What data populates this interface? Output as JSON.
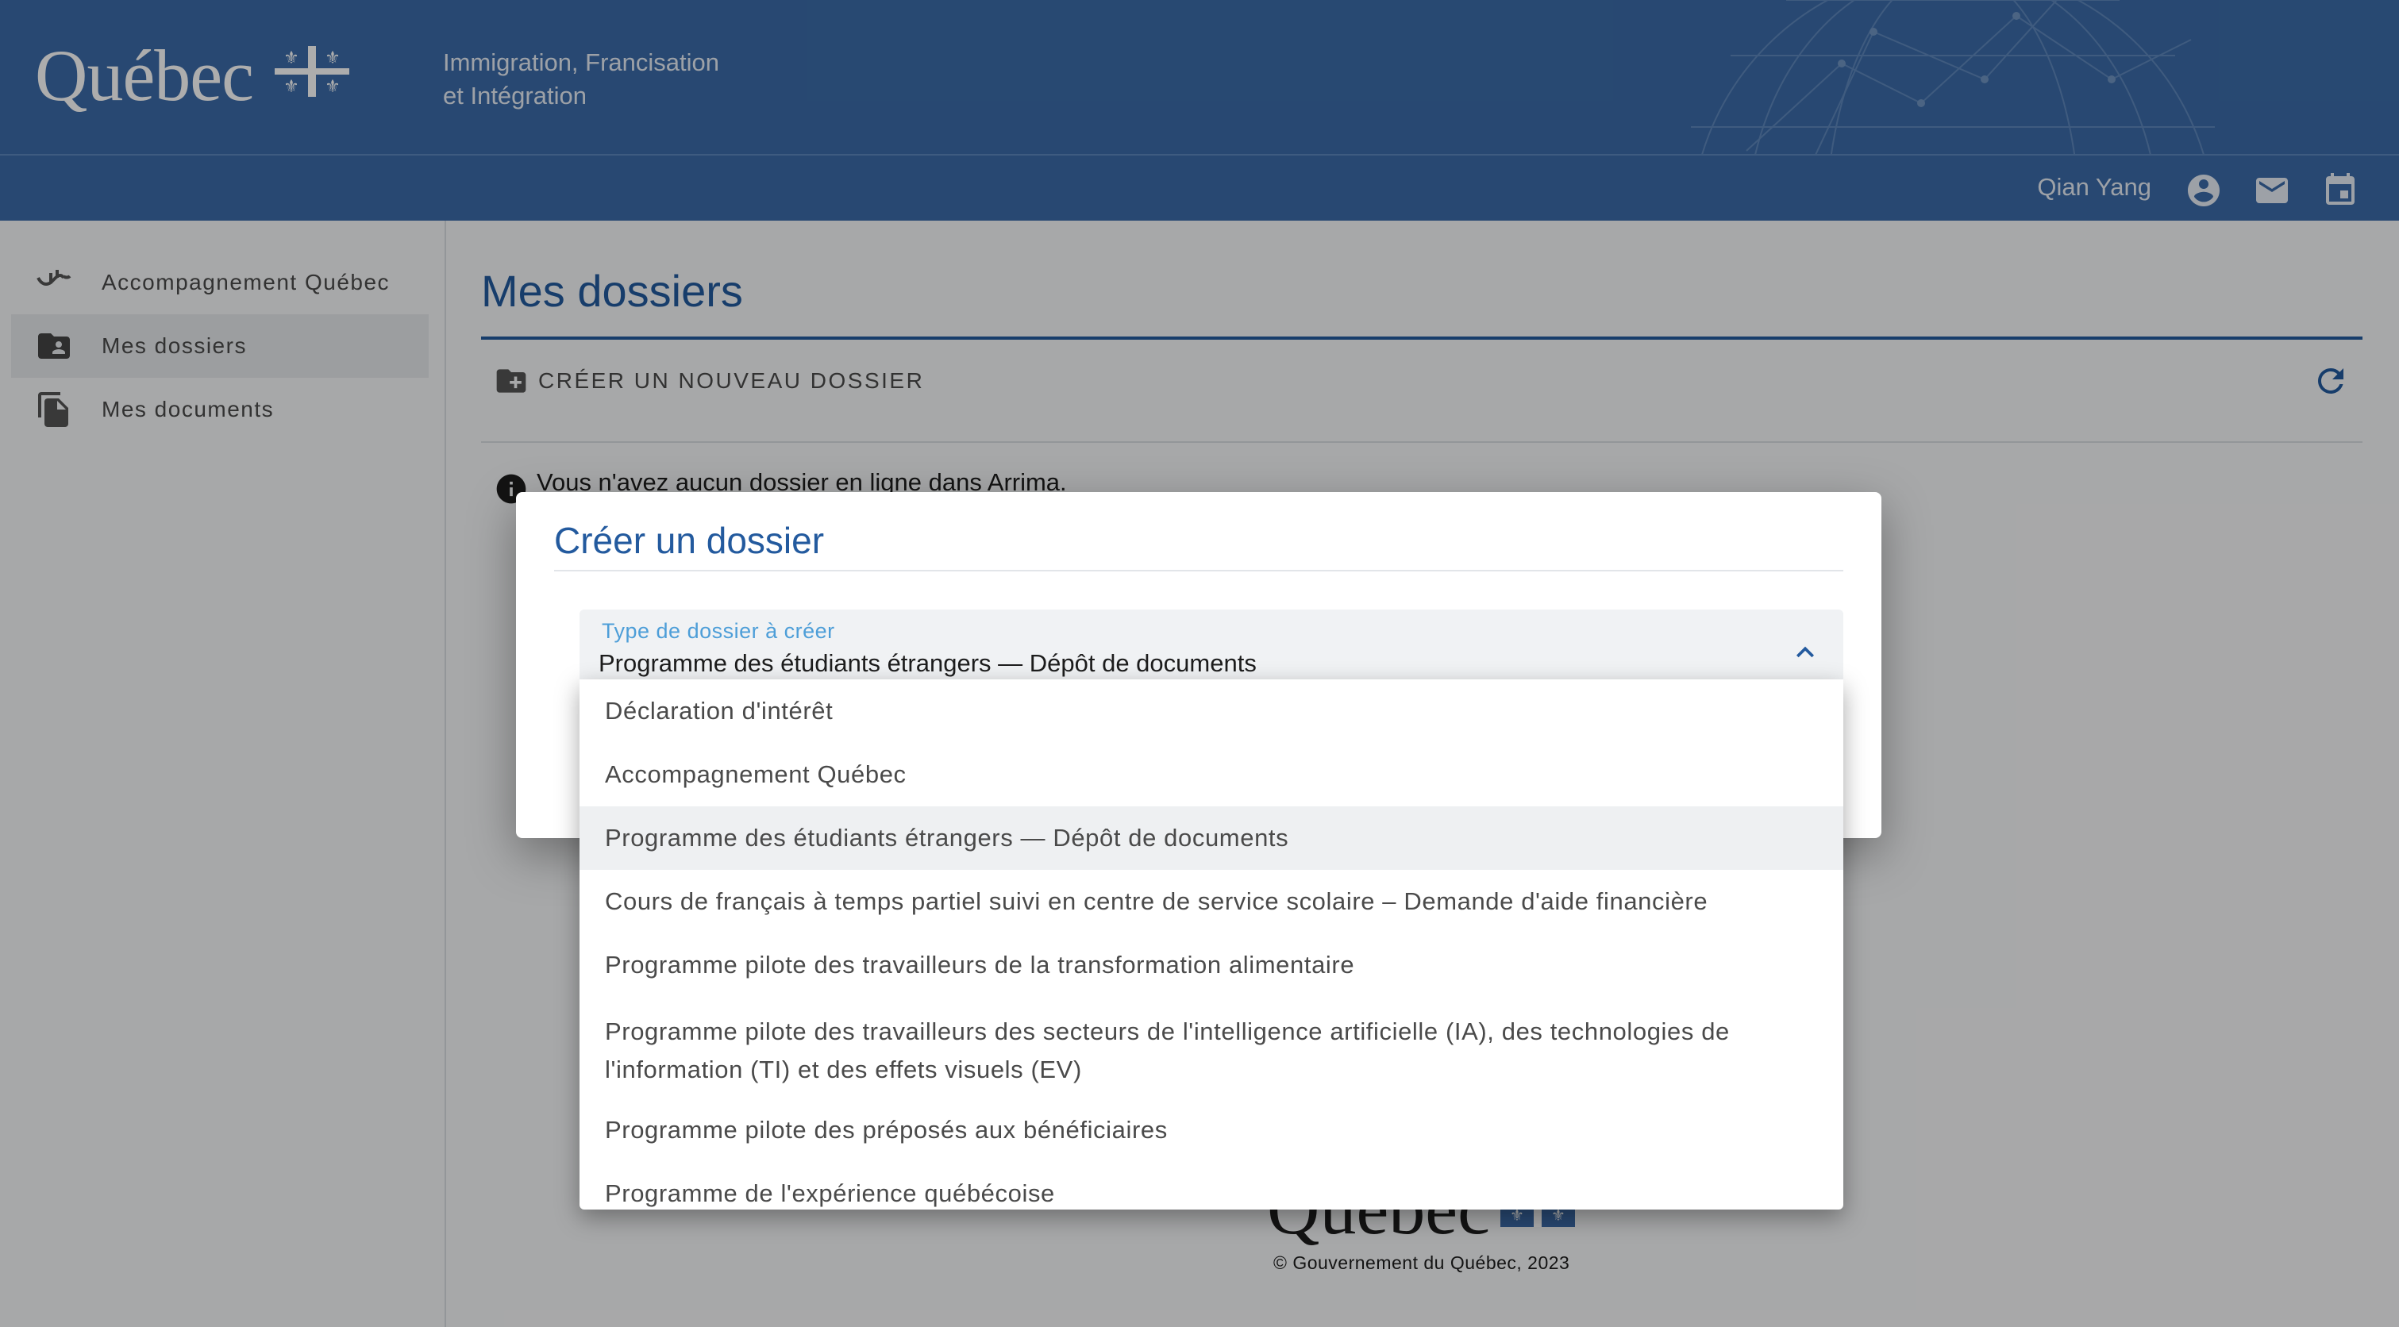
{
  "header": {
    "logo_text": "Québec",
    "ministry_line1": "Immigration, Francisation",
    "ministry_line2": "et Intégration",
    "user_name": "Qian Yang",
    "icons": [
      "account-circle-icon",
      "mail-icon",
      "calendar-icon"
    ]
  },
  "sidebar": {
    "items": [
      {
        "label": "Accompagnement Québec",
        "icon": "handshake-icon",
        "active": false
      },
      {
        "label": "Mes dossiers",
        "icon": "folder-account-icon",
        "active": true
      },
      {
        "label": "Mes documents",
        "icon": "documents-icon",
        "active": false
      }
    ]
  },
  "main": {
    "title": "Mes dossiers",
    "create_button": "CRÉER UN NOUVEAU DOSSIER",
    "info_message": "Vous n'avez aucun dossier en ligne dans Arrima.",
    "footer_logo": "Québec",
    "copyright": "© Gouvernement du Québec, 2023"
  },
  "dialog": {
    "title": "Créer un dossier",
    "field_label": "Type de dossier à créer",
    "field_value": "Programme des étudiants étrangers — Dépôt de documents",
    "options": [
      "Déclaration d'intérêt",
      "Accompagnement Québec",
      "Programme des étudiants étrangers — Dépôt de documents",
      "Cours de français à temps partiel suivi en centre de service scolaire – Demande d'aide financière",
      "Programme pilote des travailleurs de la transformation alimentaire",
      "Programme pilote des travailleurs des secteurs de l'intelligence artificielle (IA), des technologies de l'information (TI) et des effets visuels (EV)",
      "Programme pilote des préposés aux bénéficiaires",
      "Programme de l'expérience québécoise"
    ],
    "selected_index": 2
  },
  "colors": {
    "brand_blue": "#3b6ba8",
    "title_blue": "#235a9e",
    "label_blue": "#4d9ed8"
  }
}
